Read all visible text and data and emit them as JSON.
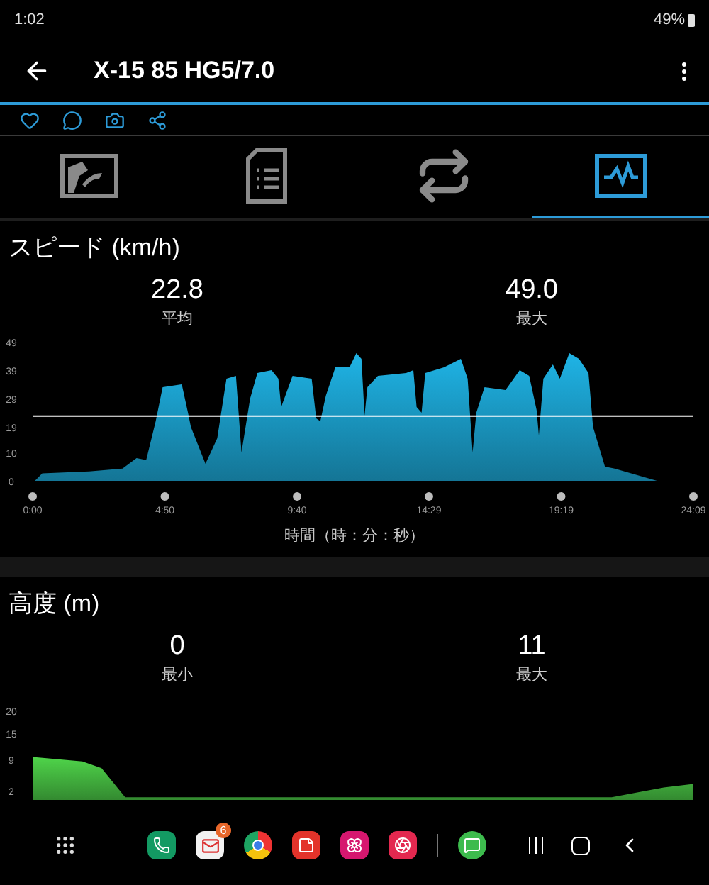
{
  "status_bar": {
    "time": "1:02",
    "battery": "49%"
  },
  "app_bar": {
    "title": "X-15 85 HG5/7.0"
  },
  "tabs": [
    {
      "kind": "map",
      "selected": false
    },
    {
      "kind": "details",
      "selected": false
    },
    {
      "kind": "laps",
      "selected": false
    },
    {
      "kind": "charts",
      "selected": true
    }
  ],
  "sections": [
    {
      "kind": "speed",
      "title": "スピード (km/h)",
      "stats": [
        {
          "value": "22.8",
          "label": "平均"
        },
        {
          "value": "49.0",
          "label": "最大"
        }
      ],
      "chart_data": {
        "type": "area",
        "xlabel": "時間（時：分：秒）",
        "xlim": [
          0,
          1449
        ],
        "ylim": [
          0,
          49
        ],
        "xticks": [
          {
            "value": 0,
            "label": "0:00"
          },
          {
            "value": 290,
            "label": "4:50"
          },
          {
            "value": 580,
            "label": "9:40"
          },
          {
            "value": 869,
            "label": "14:29"
          },
          {
            "value": 1159,
            "label": "19:19"
          },
          {
            "value": 1449,
            "label": "24:09"
          }
        ],
        "yticks": [
          0,
          10,
          19,
          29,
          39,
          49
        ],
        "x": [
          0,
          5,
          21,
          124,
          197,
          228,
          249,
          270,
          285,
          327,
          342,
          347,
          379,
          405,
          425,
          446,
          458,
          477,
          493,
          524,
          539,
          545,
          570,
          612,
          622,
          631,
          643,
          664,
          695,
          710,
          721,
          728,
          734,
          757,
          819,
          835,
          842,
          853,
          861,
          902,
          939,
          954,
          965,
          973,
          991,
          1037,
          1068,
          1089,
          1105,
          1110,
          1120,
          1141,
          1156,
          1177,
          1198,
          1219,
          1229,
          1255,
          1276,
          1369
        ],
        "series": [
          {
            "color": "#1fb4e6",
            "values": [
              0,
              0,
              2.6,
              3.3,
              4.3,
              8,
              7.3,
              21,
              33,
              34,
              23,
              19,
              6,
              15,
              36,
              37,
              10,
              29,
              38,
              39,
              36,
              26,
              37,
              36,
              22,
              21,
              30,
              40,
              40,
              45,
              43,
              23,
              33,
              37,
              38,
              39,
              26,
              24,
              38,
              40,
              43,
              36,
              10,
              24,
              33,
              32,
              39,
              37,
              25,
              16,
              36,
              41,
              36,
              45,
              43,
              38,
              19,
              5,
              4.3,
              0
            ]
          }
        ],
        "ref_lines": [
          {
            "axis": "y",
            "value": 22.8
          }
        ]
      }
    },
    {
      "kind": "elevation",
      "title": "高度 (m)",
      "stats": [
        {
          "value": "0",
          "label": "最小"
        },
        {
          "value": "11",
          "label": "最大"
        }
      ],
      "chart_data": {
        "type": "area",
        "xlim": [
          0,
          1449
        ],
        "ylim": [
          0,
          20
        ],
        "yticks": [
          2,
          9,
          15,
          20
        ],
        "x": [
          0,
          109,
          151,
          203,
          1270,
          1311,
          1384,
          1449
        ],
        "series": [
          {
            "color": "#4fd44a",
            "values": [
              9.6,
              8.6,
              7.1,
              0.6,
              0.6,
              1.4,
              2.8,
              3.6
            ]
          }
        ]
      }
    }
  ],
  "nav_bar": {
    "mail_badge": "6"
  }
}
